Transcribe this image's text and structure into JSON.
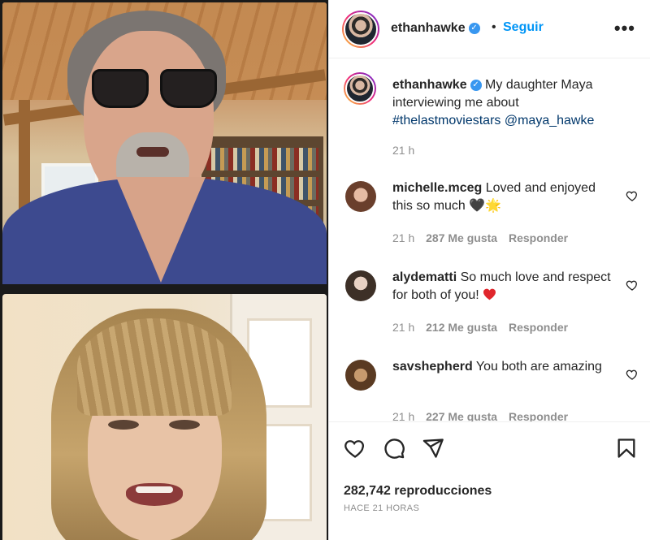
{
  "post": {
    "username": "ethanhawke",
    "follow_label": "Seguir",
    "separator": "•",
    "more_label": "•••",
    "caption_text": "My daughter Maya interviewing me about",
    "caption_hashtag": "#thelastmoviestars",
    "caption_mention": "@maya_hawke",
    "caption_time": "21 h"
  },
  "comments": [
    {
      "username": "michelle.mceg",
      "text": "Loved and enjoyed this so much",
      "emoji": "🖤🌟",
      "time": "21 h",
      "likes": "287 Me gusta",
      "reply": "Responder"
    },
    {
      "username": "alydematti",
      "text": "So much love and respect for both of you!",
      "time": "21 h",
      "likes": "212 Me gusta",
      "reply": "Responder"
    },
    {
      "username": "savshepherd",
      "text": "You both are amazing",
      "time": "21 h",
      "likes": "227 Me gusta",
      "reply": "Responder"
    }
  ],
  "footer": {
    "views": "282,742 reproducciones",
    "posted": "HACE 21 HORAS"
  },
  "icons": [
    "like-icon",
    "comment-icon",
    "share-icon",
    "save-icon",
    "verified-icon",
    "more-icon"
  ],
  "colors": {
    "link": "#0095f6",
    "hashtag": "#00376b",
    "muted": "#8e8e8e",
    "text": "#262626",
    "verified": "#3897f0"
  }
}
